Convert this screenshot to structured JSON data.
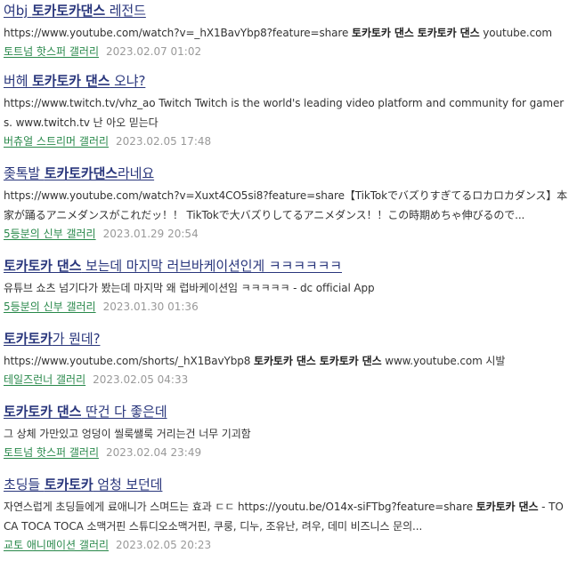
{
  "results": [
    {
      "title_pre": "여bj ",
      "title_kw": "토카토카댄스",
      "title_post": " 레전드",
      "snippet_parts": [
        {
          "t": "https://www.youtube.com/watch?v=_hX1BavYbp8?feature=share ",
          "b": false
        },
        {
          "t": "토카토카 댄스 토카토카 댄스",
          "b": true
        },
        {
          "t": " youtube.com",
          "b": false
        }
      ],
      "gallery": "토트넘 핫스퍼 갤러리",
      "date": "2023.02.07 01:02"
    },
    {
      "title_pre": "버헤 ",
      "title_kw": "토카토카 댄스",
      "title_post": " 오냐?",
      "snippet_parts": [
        {
          "t": "https://www.twitch.tv/vhz_ao Twitch Twitch is the world's leading video platform and community for gamers. www.twitch.tv 난 아오 믿는다",
          "b": false
        }
      ],
      "gallery": "버츄얼 스트리머 갤러리",
      "date": "2023.02.05 17:48"
    },
    {
      "title_pre": "좆톡발 ",
      "title_kw": "토카토카댄스",
      "title_post": "라네요",
      "snippet_parts": [
        {
          "t": "https://www.youtube.com/watch?v=Xuxt4CO5si8?feature=share【TikTokでバズりすぎてるロカロカダンス】本家が踊るアニメダンスがこれだッ！！ TikTokで大バズりしてるアニメダンス！！この時期めちゃ伸びるので...",
          "b": false
        }
      ],
      "gallery": "5등분의 신부 갤러리",
      "date": "2023.01.29 20:54"
    },
    {
      "title_pre": "",
      "title_kw": "토카토카 댄스",
      "title_post": " 보는데 마지막 러브바케이션인게 ㅋㅋㅋㅋㅋㅋ",
      "snippet_parts": [
        {
          "t": "유튜브 쇼츠 넘기다가 봤는데 마지막 왜 럽바케이션임 ㅋㅋㅋㅋㅋ - dc official App",
          "b": false
        }
      ],
      "gallery": "5등분의 신부 갤러리",
      "date": "2023.01.30 01:36"
    },
    {
      "title_pre": "",
      "title_kw": "토카토카",
      "title_post": "가 뭔데?",
      "snippet_parts": [
        {
          "t": "https://www.youtube.com/shorts/_hX1BavYbp8 ",
          "b": false
        },
        {
          "t": "토카토카 댄스 토카토카 댄스",
          "b": true
        },
        {
          "t": " www.youtube.com 시발",
          "b": false
        }
      ],
      "gallery": "테일즈런너 갤러리",
      "date": "2023.02.05 04:33"
    },
    {
      "title_pre": "",
      "title_kw": "토카토카 댄스",
      "title_post": " 딴건 다 좋은데",
      "snippet_parts": [
        {
          "t": "그 상체 가만있고 엉덩이 씰룩쌜룩 거리는건 너무 기괴함",
          "b": false
        }
      ],
      "gallery": "토트넘 핫스퍼 갤러리",
      "date": "2023.02.04 23:49"
    },
    {
      "title_pre": "초딩들 ",
      "title_kw": "토카토카",
      "title_post": " 엄청 보던데",
      "snippet_parts": [
        {
          "t": "자연스럽게 초딩들에게 료애니가 스며드는 효과 ㄷㄷ https://youtu.be/O14x-siFTbg?feature=share ",
          "b": false
        },
        {
          "t": "토카토카 댄스",
          "b": true
        },
        {
          "t": " - TOCA TOCA TOCA 소맥거핀 스튜디오소맥거핀, 쿠룽, 디누, 조유난, 려우, 데미 비즈니스 문의...",
          "b": false
        }
      ],
      "gallery": "교토 애니메이션 갤러리",
      "date": "2023.02.05 20:23"
    }
  ]
}
